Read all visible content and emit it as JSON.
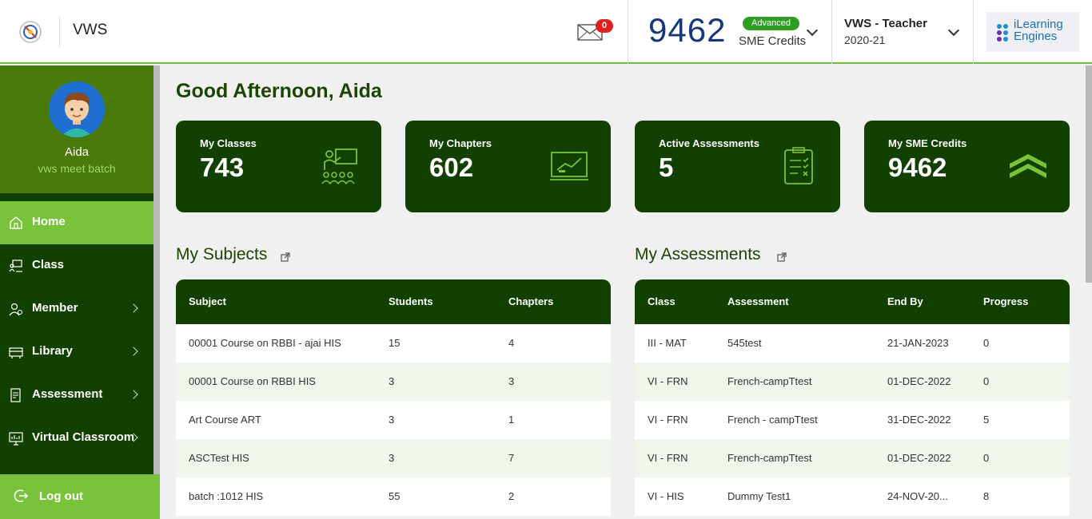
{
  "header": {
    "brand": "VWS",
    "mail_count": "0",
    "credits": "9462",
    "plan_badge": "Advanced",
    "credits_label": "SME Credits",
    "role": "VWS - Teacher",
    "year": "2020-21",
    "partner_logo_line1": "iLearning",
    "partner_logo_line2": "Engines"
  },
  "sidebar": {
    "user_name": "Aida",
    "batch": "vws meet batch",
    "items": [
      {
        "label": "Home",
        "icon": "home-icon",
        "active": true,
        "submenu": false
      },
      {
        "label": "Class",
        "icon": "class-icon",
        "active": false,
        "submenu": false
      },
      {
        "label": "Member",
        "icon": "member-icon",
        "active": false,
        "submenu": true
      },
      {
        "label": "Library",
        "icon": "library-icon",
        "active": false,
        "submenu": true
      },
      {
        "label": "Assessment",
        "icon": "assessment-icon",
        "active": false,
        "submenu": true
      },
      {
        "label": "Virtual Classroom",
        "icon": "virtual-classroom-icon",
        "active": false,
        "submenu": true
      }
    ],
    "logout": "Log out"
  },
  "main": {
    "greeting": "Good Afternoon, Aida",
    "cards": [
      {
        "title": "My Classes",
        "value": "743",
        "icon": "teacher-classroom-icon"
      },
      {
        "title": "My Chapters",
        "value": "602",
        "icon": "presentation-board-icon"
      },
      {
        "title": "Active Assessments",
        "value": "5",
        "icon": "clipboard-checklist-icon"
      },
      {
        "title": "My SME Credits",
        "value": "9462",
        "icon": "chevron-rank-icon"
      }
    ],
    "subjects": {
      "title": "My Subjects",
      "columns": [
        "Subject",
        "Students",
        "Chapters"
      ],
      "rows": [
        [
          "00001 Course on RBBI - ajai HIS",
          "15",
          "4"
        ],
        [
          "00001 Course on RBBI HIS",
          "3",
          "3"
        ],
        [
          "Art Course ART",
          "3",
          "1"
        ],
        [
          "ASCTest HIS",
          "3",
          "7"
        ],
        [
          "batch :1012 HIS",
          "55",
          "2"
        ]
      ]
    },
    "assessments": {
      "title": "My Assessments",
      "columns": [
        "Class",
        "Assessment",
        "End By",
        "Progress"
      ],
      "rows": [
        [
          "III - MAT",
          "545test",
          "21-JAN-2023",
          "0"
        ],
        [
          "VI - FRN",
          "French-campTtest",
          "01-DEC-2022",
          "0"
        ],
        [
          "VI - FRN",
          "French - campTtest",
          "31-DEC-2022",
          "5"
        ],
        [
          "VI - FRN",
          "French-campTtest",
          "01-DEC-2022",
          "0"
        ],
        [
          "VI - HIS",
          "Dummy Test1",
          "24-NOV-20...",
          "8"
        ]
      ]
    }
  },
  "colors": {
    "dark_green": "#124000",
    "accent_green": "#7ac23a",
    "credits_blue": "#16387a",
    "badge_red": "#e02020"
  }
}
